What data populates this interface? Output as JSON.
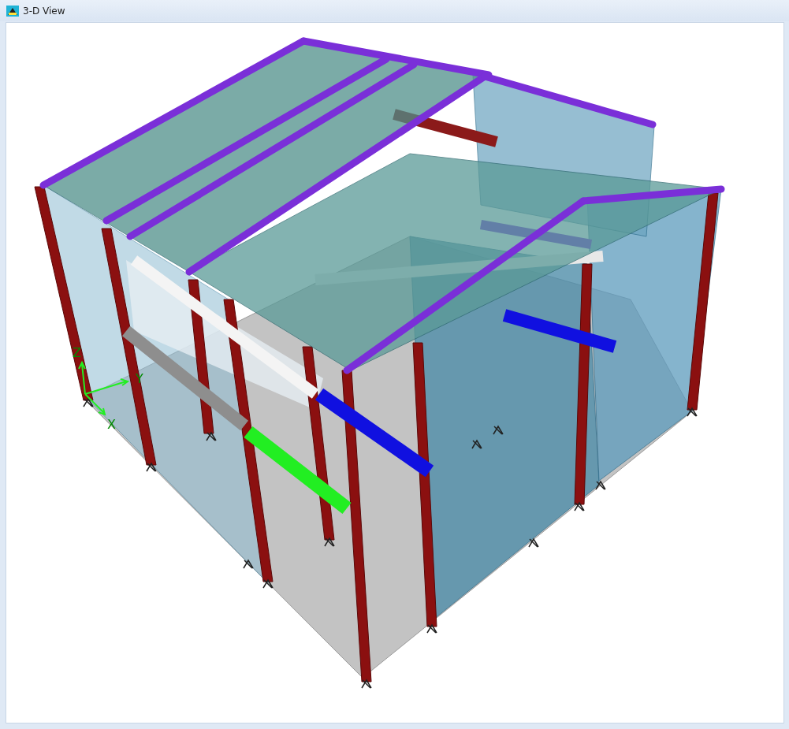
{
  "window": {
    "title": "3-D View"
  },
  "axes": [
    {
      "label": "Z"
    },
    {
      "label": "Y"
    },
    {
      "label": "X"
    }
  ]
}
